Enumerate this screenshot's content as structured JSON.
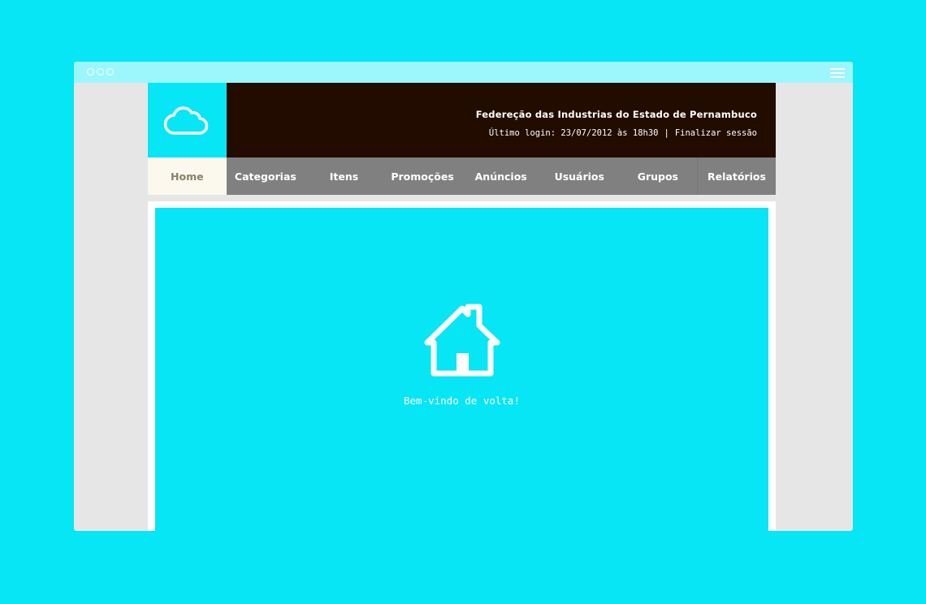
{
  "window": {
    "controls": [
      "circle-control",
      "circle-control",
      "circle-control"
    ],
    "menu_icon": "hamburger-icon"
  },
  "logo": {
    "icon": "cloud-icon",
    "color": "#ffffff",
    "background": "#06e6f4"
  },
  "header": {
    "organization": "Federeção das Industrias do Estado de Pernambuco",
    "last_login": "Último login: 23/07/2012 às 18h30",
    "separator": "|",
    "logout_label": "Finalizar sessão",
    "background": "#220c00"
  },
  "nav": {
    "items": [
      {
        "label": "Home",
        "active": true
      },
      {
        "label": "Categorias",
        "active": false
      },
      {
        "label": "Itens",
        "active": false
      },
      {
        "label": "Promoções",
        "active": false
      },
      {
        "label": "Anúncios",
        "active": false
      },
      {
        "label": "Usuários",
        "active": false
      },
      {
        "label": "Grupos",
        "active": false
      },
      {
        "label": "Relatórios",
        "active": false
      }
    ],
    "background": "#808080",
    "active_background": "#fbf8ee"
  },
  "main": {
    "icon": "house-icon",
    "welcome": "Bem-vindo de volta!",
    "background": "#06e6f4"
  }
}
